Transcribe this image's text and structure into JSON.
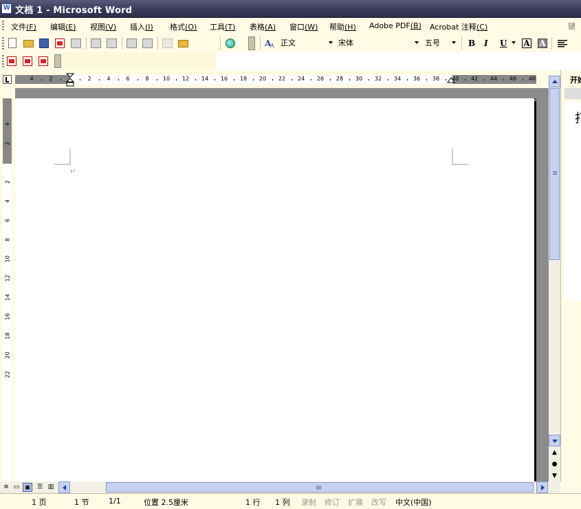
{
  "window": {
    "title": "文档 1 - Microsoft Word"
  },
  "menu": {
    "items": [
      {
        "label": "文件",
        "key": "(F)"
      },
      {
        "label": "编辑",
        "key": "(E)"
      },
      {
        "label": "视图",
        "key": "(V)"
      },
      {
        "label": "插入",
        "key": "(I)"
      },
      {
        "label": "格式",
        "key": "(O)"
      },
      {
        "label": "工具",
        "key": "(T)"
      },
      {
        "label": "表格",
        "key": "(A)"
      },
      {
        "label": "窗口",
        "key": "(W)"
      },
      {
        "label": "帮助",
        "key": "(H)"
      },
      {
        "label": "Adobe PDF",
        "key": "(B)"
      },
      {
        "label": "Acrobat 注释",
        "key": "(C)"
      }
    ],
    "help_box": "键入"
  },
  "formatting": {
    "style": "正文",
    "font": "宋体",
    "size": "五号",
    "bold": "B",
    "italic": "I",
    "underline": "U",
    "char_border": "A",
    "char_shading": "A"
  },
  "ruler": {
    "h_labels": [
      "4",
      "2",
      "2",
      "4",
      "6",
      "8",
      "10",
      "12",
      "14",
      "16",
      "18",
      "20",
      "22",
      "24",
      "26",
      "28",
      "30",
      "32",
      "34",
      "36",
      "38",
      "40",
      "42",
      "44",
      "46",
      "48"
    ],
    "v_labels": [
      "4",
      "2",
      "2",
      "4",
      "6",
      "8",
      "10",
      "12",
      "14",
      "16",
      "18",
      "20",
      "22"
    ]
  },
  "document": {
    "paragraph_mark": "↵"
  },
  "taskpane": {
    "title": "开始",
    "big_char": "打"
  },
  "status": {
    "page": "1 页",
    "section": "1 节",
    "page_of": "1/1",
    "position": "位置 2.5厘米",
    "line": "1 行",
    "column": "1 列",
    "rec": "录制",
    "trk": "修订",
    "ext": "扩展",
    "ovr": "改写",
    "language": "中文(中国)"
  },
  "icons": [
    "word-app-icon",
    "new-doc-icon",
    "open-folder-icon",
    "save-icon",
    "permission-icon",
    "print-icon",
    "print-preview-icon",
    "spelling-icon",
    "research-icon",
    "copy-icon",
    "paste-icon",
    "format-painter-icon",
    "hyperlink-icon",
    "toolbar-options-icon",
    "styles-pane-icon",
    "align-left-icon",
    "pdf-convert-icon",
    "pdf-email-icon",
    "pdf-review-icon"
  ]
}
